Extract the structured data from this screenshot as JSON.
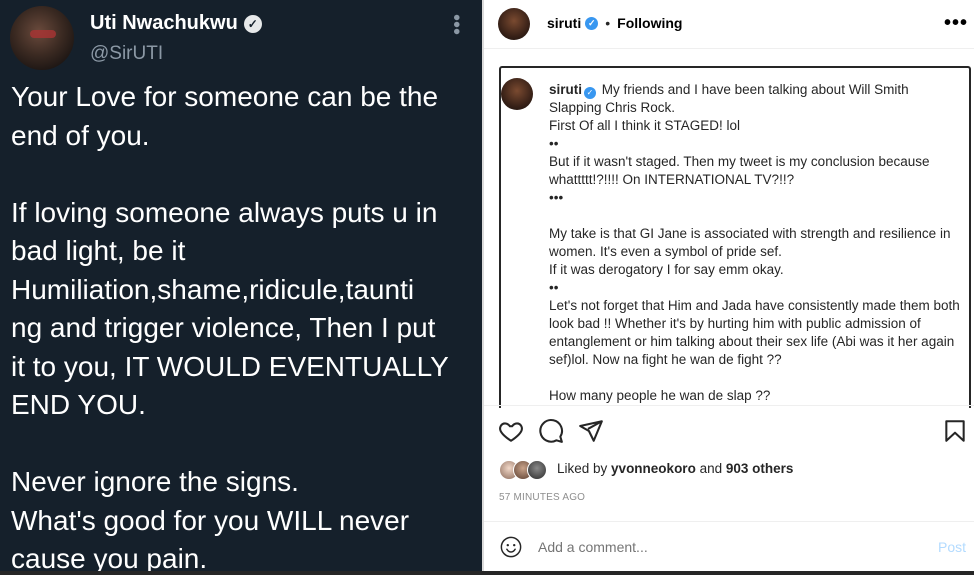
{
  "tweet": {
    "name": "Uti Nwachukwu",
    "handle": "@SirUTI",
    "verified_glyph": "✓",
    "more_glyph": "•••",
    "text": "Your Love for someone can be the\nend of you.\n\nIf loving someone always puts u in\nbad light, be it\nHumiliation,shame,ridicule,taunti\nng and trigger violence, Then I put\nit to you, IT WOULD EVENTUALLY\nEND YOU.\n\nNever ignore the signs.\nWhat's good for you WILL never\ncause you pain."
  },
  "instagram": {
    "username": "siruti",
    "dot": "•",
    "follow_status": "Following",
    "more_glyph": "•••",
    "caption_user": "siruti",
    "caption": "My friends and I have been talking about Will Smith Slapping Chris Rock.\nFirst Of all I think it STAGED! lol\n••\nBut if it wasn't staged. Then my tweet is my conclusion because whattttt!?!!!! On INTERNATIONAL TV?!!?\n•••\n\nMy take is that GI Jane is associated with strength and resilience in women. It's even a symbol of pride sef.\nIf it was derogatory I for say emm okay.\n••\nLet's not forget that Him and Jada have consistently made them both look bad !! Whether it's by hurting him with public admission of entanglement or him talking about their sex life (Abi was it her again sef)lol. Now na fight he wan de fight ??\n\nHow many people he wan de slap ??",
    "liked_by_prefix": "Liked by ",
    "liked_by_user": "yvonneokoro",
    "liked_by_and": " and ",
    "liked_by_count": "903 others",
    "time_ago": "57 MINUTES AGO",
    "comment_placeholder": "Add a comment...",
    "post_label": "Post",
    "colors": {
      "verified_blue": "#3897f0",
      "post_disabled": "#b3dbff",
      "tweet_bg": "#15202b"
    },
    "icons": [
      "heart-icon",
      "comment-icon",
      "share-icon",
      "bookmark-icon",
      "smiley-icon"
    ]
  }
}
